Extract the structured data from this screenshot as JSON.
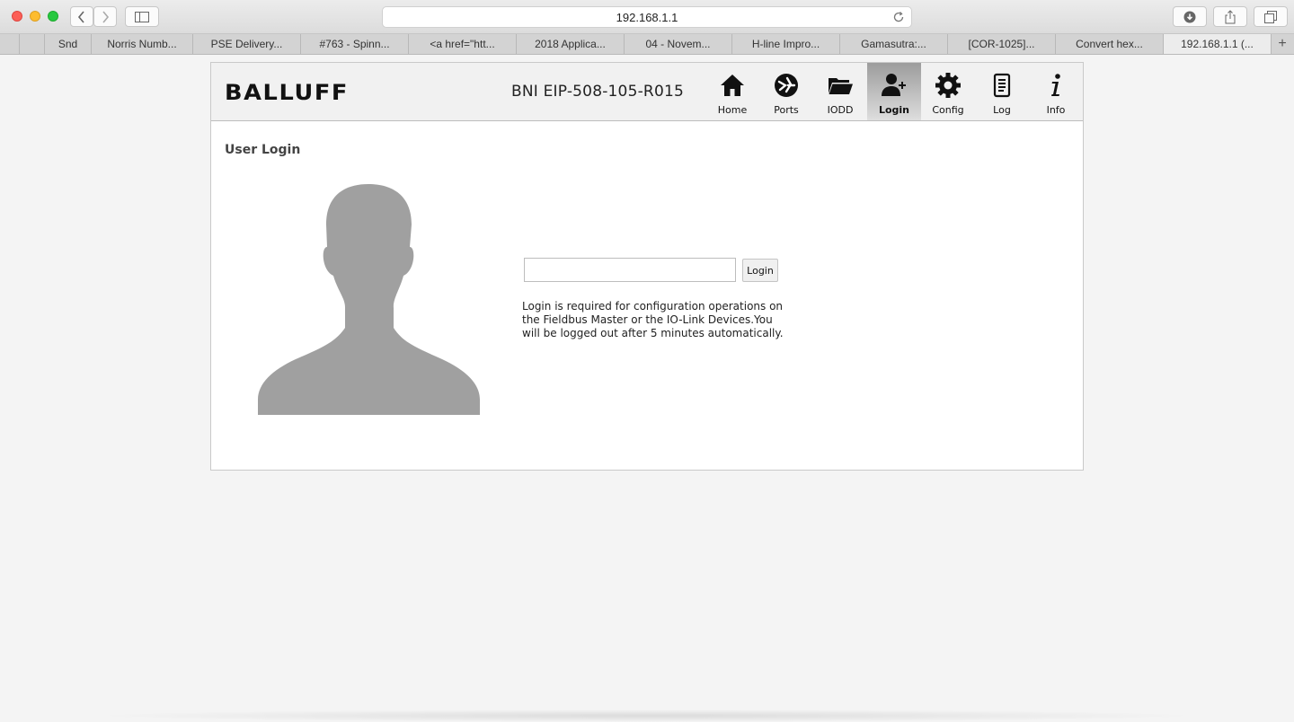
{
  "browser": {
    "url": "192.168.1.1",
    "tabs": [
      {
        "label": "",
        "width": 22
      },
      {
        "label": "",
        "width": 28
      },
      {
        "label": "Snd",
        "width": 52
      },
      {
        "label": "Norris Numb...",
        "width": 113
      },
      {
        "label": "PSE Delivery...",
        "width": 120
      },
      {
        "label": "#763 - Spinn...",
        "width": 120
      },
      {
        "label": "<a href=\"htt...",
        "width": 120
      },
      {
        "label": "2018 Applica...",
        "width": 120
      },
      {
        "label": "04 - Novem...",
        "width": 120
      },
      {
        "label": "H-line Impro...",
        "width": 120
      },
      {
        "label": "Gamasutra:...",
        "width": 120
      },
      {
        "label": "[COR-1025]...",
        "width": 120
      },
      {
        "label": "Convert hex...",
        "width": 120
      },
      {
        "label": "192.168.1.1 (...",
        "width": 120,
        "active": true
      }
    ],
    "new_tab": "+"
  },
  "header": {
    "brand": "BALLUFF",
    "device": "BNI EIP-508-105-R015",
    "nav": [
      {
        "label": "Home",
        "icon": "home-icon"
      },
      {
        "label": "Ports",
        "icon": "ports-icon"
      },
      {
        "label": "IODD",
        "icon": "folder-icon"
      },
      {
        "label": "Login",
        "icon": "user-add-icon",
        "active": true
      },
      {
        "label": "Config",
        "icon": "gear-icon"
      },
      {
        "label": "Log",
        "icon": "document-icon"
      },
      {
        "label": "Info",
        "icon": "info-icon"
      }
    ]
  },
  "main": {
    "title": "User Login",
    "password_value": "",
    "login_button": "Login",
    "help_text": "Login is required for configuration operations on the Fieldbus Master or the IO-Link Devices.You will be logged out after 5 minutes automatically."
  },
  "colors": {
    "active_nav": "#9c9c9c",
    "avatar": "#a0a0a0"
  }
}
